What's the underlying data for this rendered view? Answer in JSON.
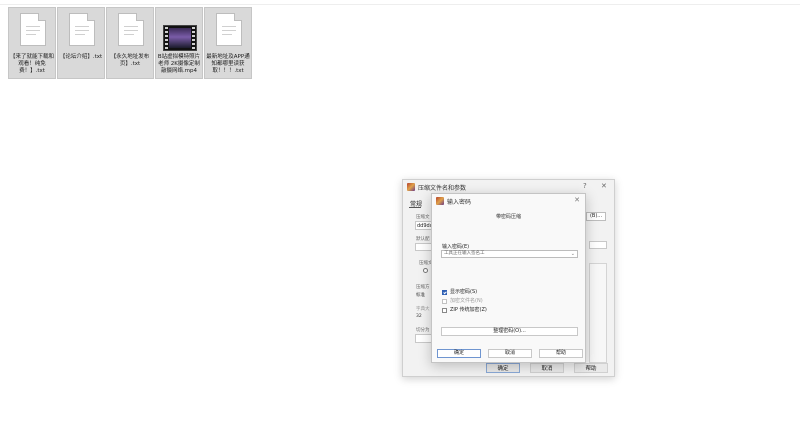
{
  "files": [
    {
      "name": "【来了就能下载和观看！纯免费！】.txt",
      "kind": "text"
    },
    {
      "name": "【论坛介绍】.txt",
      "kind": "text"
    },
    {
      "name": "【永久地址发布页】.txt",
      "kind": "text"
    },
    {
      "name": "B站虚拟模特照片老师 2K摄像定制 敲摄网络.mp4",
      "kind": "video"
    },
    {
      "name": "最新地址及APP通知都哪里读获取！！！.txt",
      "kind": "text"
    }
  ],
  "back_dialog": {
    "title": "压缩文件名和参数",
    "help_glyph": "?",
    "close_glyph": "✕",
    "tab_general": "常规",
    "frag_archive_name_label": "压缩文",
    "frag_archive_name_value": "dd9dc",
    "frag_browse": "(B)...",
    "frag_default_label": "默认配",
    "frag_format_label": "压缩文",
    "frag_method_label": "压缩方",
    "frag_method_value": "标准",
    "frag_dict_label": "字典大",
    "frag_dict_value": "32",
    "frag_split_label": "切分为",
    "ok_label": "确定",
    "cancel_label": "取消",
    "help_label": "帮助"
  },
  "password_dialog": {
    "title": "输入密码",
    "close_glyph": "✕",
    "heading": "带密码压缩",
    "password_label": "输入密码(E)",
    "password_placeholder": "工具正在输入签名工",
    "dropdown_glyph": "⌄",
    "show_password_label": "显示密码(S)",
    "encrypt_filenames_label": "加密文件名(N)",
    "zip_legacy_label": "ZIP 传统加密(Z)",
    "organize_label": "整理密码(O)...",
    "ok_label": "确定",
    "cancel_label": "取消",
    "help_label": "帮助"
  }
}
